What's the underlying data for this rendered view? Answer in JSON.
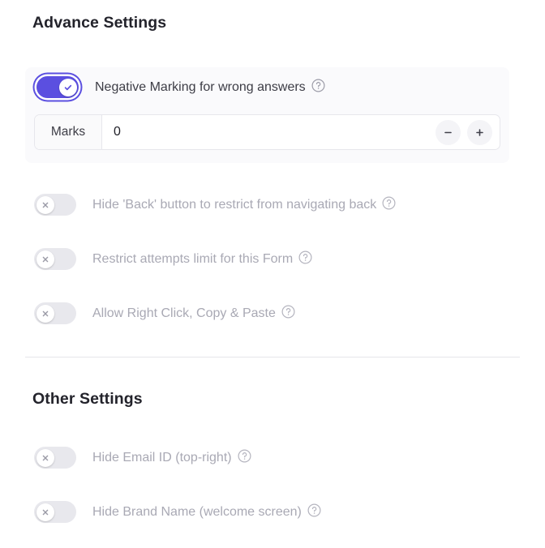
{
  "sections": {
    "advance": {
      "title": "Advance Settings"
    },
    "other": {
      "title": "Other Settings"
    }
  },
  "negative_marking": {
    "label": "Negative Marking for wrong answers",
    "toggle_state": "on",
    "help_icon": "help-circle-icon",
    "marks": {
      "prefix_label": "Marks",
      "value": "0",
      "placeholder": "0",
      "decrement_label": "−",
      "increment_label": "+"
    }
  },
  "advance_rows": [
    {
      "label": "Hide 'Back' button to restrict from navigating back",
      "toggle_state": "off",
      "help_icon": "help-circle-icon"
    },
    {
      "label": "Restrict attempts limit for this Form",
      "toggle_state": "off",
      "help_icon": "help-circle-icon"
    },
    {
      "label": "Allow Right Click, Copy & Paste",
      "toggle_state": "off",
      "help_icon": "help-circle-icon"
    }
  ],
  "other_rows": [
    {
      "label": "Hide Email ID (top-right)",
      "toggle_state": "off",
      "help_icon": "help-circle-icon"
    },
    {
      "label": "Hide Brand Name (welcome screen)",
      "toggle_state": "off",
      "help_icon": "help-circle-icon"
    }
  ],
  "colors": {
    "accent": "#5b4fe0",
    "card_background": "#fafafc",
    "toggle_off_track": "#e8e8ed",
    "label_active": "#3d3d46",
    "label_disabled": "#a9a9b4",
    "divider": "#e6e6ea"
  }
}
